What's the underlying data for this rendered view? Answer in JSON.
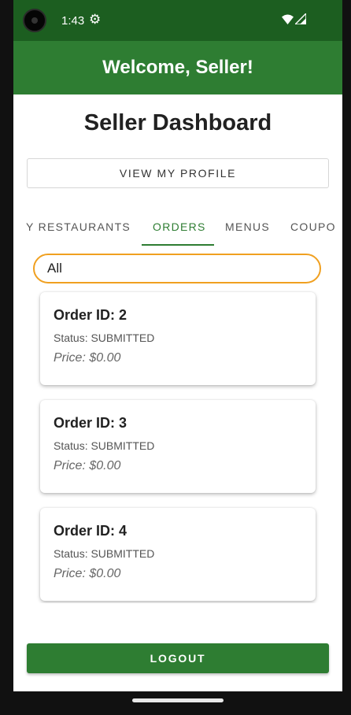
{
  "status_bar": {
    "time": "1:43",
    "settings_icon": "gear-icon",
    "wifi_icon": "wifi-icon",
    "signal_icon": "signal-icon"
  },
  "app_bar": {
    "title": "Welcome, Seller!"
  },
  "page": {
    "title": "Seller Dashboard"
  },
  "profile_button": {
    "label": "VIEW MY PROFILE"
  },
  "tabs": [
    {
      "label": "Y RESTAURANTS",
      "active": false
    },
    {
      "label": "ORDERS",
      "active": true
    },
    {
      "label": "MENUS",
      "active": false
    },
    {
      "label": "COUPO",
      "active": false
    }
  ],
  "filter": {
    "value": "All"
  },
  "orders": [
    {
      "id": "Order ID: 2",
      "status": "Status: SUBMITTED",
      "price": "Price: $0.00"
    },
    {
      "id": "Order ID: 3",
      "status": "Status: SUBMITTED",
      "price": "Price: $0.00"
    },
    {
      "id": "Order ID: 4",
      "status": "Status: SUBMITTED",
      "price": "Price: $0.00"
    }
  ],
  "logout_button": {
    "label": "LOGOUT"
  },
  "colors": {
    "primary": "#2e7d32",
    "status_bar": "#1c5e20",
    "filter_border": "#f0a020"
  }
}
